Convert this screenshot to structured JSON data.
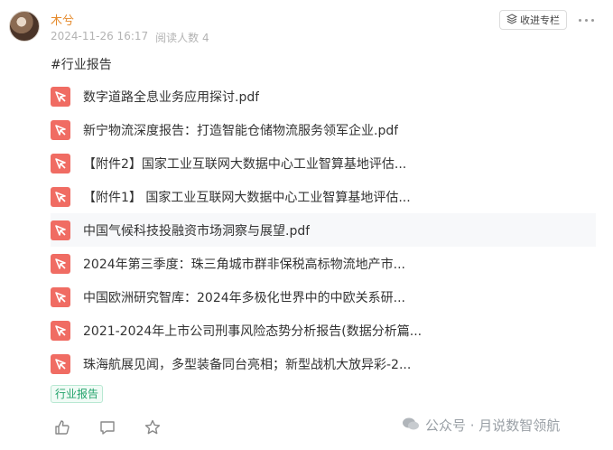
{
  "post": {
    "author": "木兮",
    "date": "2024-11-26 16:17",
    "read_count": "阅读人数 4",
    "collect_label": "收进专栏",
    "hashtag": "#行业报告",
    "tag": "行业报告"
  },
  "files": [
    {
      "name": "数字道路全息业务应用探讨.pdf"
    },
    {
      "name": "新宁物流深度报告：打造智能仓储物流服务领军企业.pdf"
    },
    {
      "name": "【附件2】国家工业互联网大数据中心工业智算基地评估..."
    },
    {
      "name": "【附件1】 国家工业互联网大数据中心工业智算基地评估..."
    },
    {
      "name": "中国气候科技投融资市场洞察与展望.pdf"
    },
    {
      "name": "2024年第三季度：珠三角城市群非保税高标物流地产市..."
    },
    {
      "name": "中国欧洲研究智库：2024年多极化世界中的中欧关系研..."
    },
    {
      "name": "2021-2024年上市公司刑事风险态势分析报告(数据分析篇..."
    },
    {
      "name": "珠海航展见闻，多型装备同台亮相；新型战机大放异彩-2..."
    }
  ],
  "watermark": "公众号 · 月说数智领航",
  "colors": {
    "author": "#e58a2c",
    "pdf_icon": "#f06c63",
    "tag_text": "#22a36b"
  }
}
